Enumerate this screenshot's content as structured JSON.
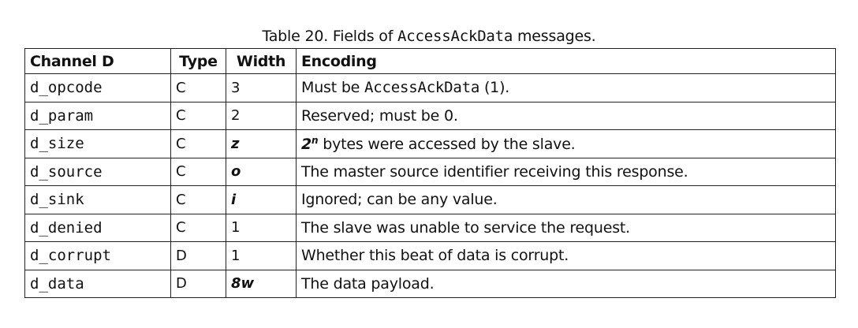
{
  "caption": {
    "prefix": "Table 20. Fields of ",
    "code": "AccessAckData",
    "suffix": " messages."
  },
  "headers": {
    "channel": "Channel D",
    "type": "Type",
    "width": "Width",
    "encoding": "Encoding"
  },
  "rows": [
    {
      "field": "d_opcode",
      "type": "C",
      "width": "3",
      "enc_pre": "Must be ",
      "enc_code": "AccessAckData",
      "enc_post": " (1)."
    },
    {
      "field": "d_param",
      "type": "C",
      "width": "2",
      "encoding": "Reserved; must be 0."
    },
    {
      "field": "d_size",
      "type": "C",
      "width": "z",
      "enc_base": "2",
      "enc_sup": "n",
      "enc_rest": " bytes were accessed by the slave."
    },
    {
      "field": "d_source",
      "type": "C",
      "width": "o",
      "encoding": "The master source identifier receiving this response."
    },
    {
      "field": "d_sink",
      "type": "C",
      "width": "i",
      "encoding": "Ignored; can be any value."
    },
    {
      "field": "d_denied",
      "type": "C",
      "width": "1",
      "encoding": "The slave was unable to service the request."
    },
    {
      "field": "d_corrupt",
      "type": "D",
      "width": "1",
      "encoding": "Whether this beat of data is corrupt."
    },
    {
      "field": "d_data",
      "type": "D",
      "width": "8w",
      "encoding": "The data payload."
    }
  ]
}
